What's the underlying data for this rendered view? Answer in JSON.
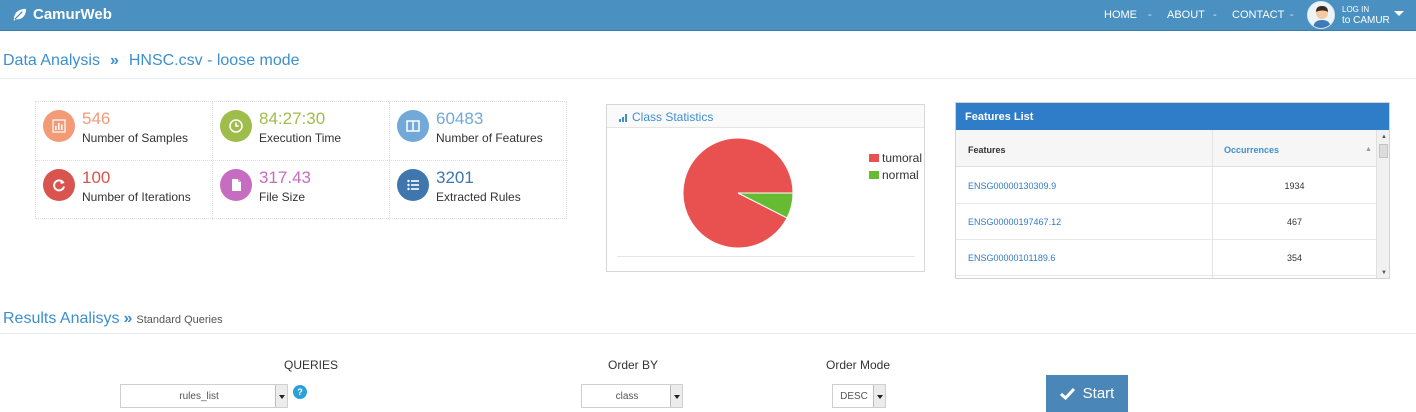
{
  "app": {
    "brand": "CamurWeb"
  },
  "nav": {
    "home": "HOME",
    "about": "ABOUT",
    "contact": "CONTACT",
    "sep": "-",
    "login_line1": "LOG IN",
    "login_line2": "to CAMUR"
  },
  "breadcrumb": {
    "root": "Data Analysis",
    "sep": "»",
    "current": "HNSC.csv - loose mode"
  },
  "stats": [
    {
      "value": "546",
      "label": "Number of Samples",
      "icon": "bar-chart-icon",
      "color": "#f39a77"
    },
    {
      "value": "84:27:30",
      "label": "Execution Time",
      "icon": "clock-icon",
      "color": "#9fbd4b"
    },
    {
      "value": "60483",
      "label": "Number of Features",
      "icon": "columns-icon",
      "color": "#72a9d8"
    },
    {
      "value": "100",
      "label": "Number of Iterations",
      "icon": "refresh-icon",
      "color": "#d9534f"
    },
    {
      "value": "317.43",
      "label": "File Size",
      "icon": "file-icon",
      "color": "#c66dc2"
    },
    {
      "value": "3201",
      "label": "Extracted Rules",
      "icon": "list-icon",
      "color": "#3f76ad"
    }
  ],
  "class_statistics": {
    "title": "Class Statistics",
    "legend": [
      {
        "label": "tumoral",
        "color": "#e8514f"
      },
      {
        "label": "normal",
        "color": "#66bb33"
      }
    ]
  },
  "chart_data": {
    "type": "pie",
    "title": "Class Statistics",
    "labels": [
      "tumoral",
      "normal"
    ],
    "values": [
      92.5,
      7.5
    ],
    "colors": [
      "#e8514f",
      "#66bb33"
    ],
    "legend": "right"
  },
  "features_list": {
    "title": "Features List",
    "col_features": "Features",
    "col_occurrences": "Occurrences",
    "rows": [
      {
        "feature": "ENSG00000130309.9",
        "occurrences": "1934"
      },
      {
        "feature": "ENSG00000197467.12",
        "occurrences": "467"
      },
      {
        "feature": "ENSG00000101189.6",
        "occurrences": "354"
      }
    ]
  },
  "results": {
    "title": "Results Analisys",
    "arrows": "»",
    "subtitle": "Standard Queries",
    "queries_label": "QUERIES",
    "queries_value": "rules_list",
    "help": "?",
    "order_by_label": "Order BY",
    "order_by_value": "class",
    "order_mode_label": "Order Mode",
    "order_mode_value": "DESC",
    "start_label": "Start"
  }
}
